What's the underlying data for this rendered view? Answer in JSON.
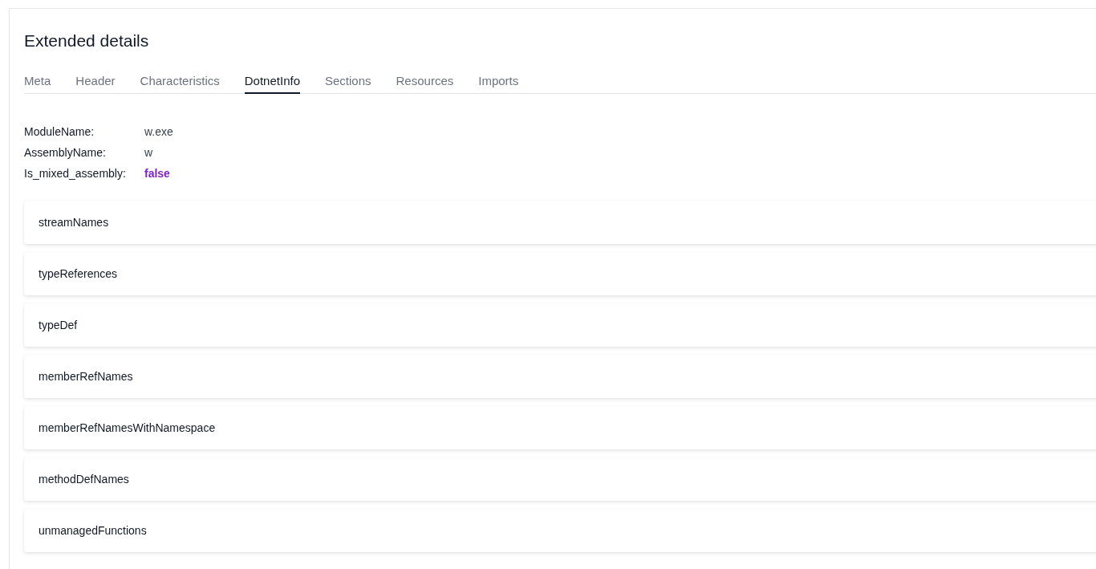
{
  "title": "Extended details",
  "tabs": [
    {
      "label": "Meta",
      "selected": false
    },
    {
      "label": "Header",
      "selected": false
    },
    {
      "label": "Characteristics",
      "selected": false
    },
    {
      "label": "DotnetInfo",
      "selected": true
    },
    {
      "label": "Sections",
      "selected": false
    },
    {
      "label": "Resources",
      "selected": false
    },
    {
      "label": "Imports",
      "selected": false
    }
  ],
  "fields": [
    {
      "label": "ModuleName:",
      "value": "w.exe",
      "kind": "text"
    },
    {
      "label": "AssemblyName:",
      "value": "w",
      "kind": "text"
    },
    {
      "label": "Is_mixed_assembly:",
      "value": "false",
      "kind": "boolean"
    }
  ],
  "panels": [
    {
      "title": "streamNames",
      "expanded": false
    },
    {
      "title": "typeReferences",
      "expanded": false
    },
    {
      "title": "typeDef",
      "expanded": false
    },
    {
      "title": "memberRefNames",
      "expanded": false
    },
    {
      "title": "memberRefNamesWithNamespace",
      "expanded": false
    },
    {
      "title": "methodDefNames",
      "expanded": false
    },
    {
      "title": "unmanagedFunctions",
      "expanded": false
    }
  ]
}
